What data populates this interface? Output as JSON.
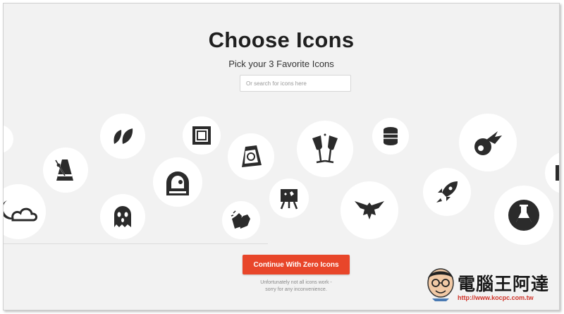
{
  "header": {
    "title": "Choose Icons",
    "subtitle": "Pick your 3 Favorite Icons"
  },
  "search": {
    "placeholder": "Or search for icons here",
    "value": ""
  },
  "icons": [
    "leaves-icon",
    "metronome-icon",
    "cloud-night-icon",
    "frame-icon",
    "astronaut-icon",
    "ghost-icon",
    "ring-box-icon",
    "clapping-hands-icon",
    "champagne-icon",
    "easel-icon",
    "database-icon",
    "eagle-icon",
    "comet-icon",
    "rocket-icon",
    "flask-icon"
  ],
  "cta": {
    "label": "Continue With Zero Icons",
    "accent_color": "#e8462a"
  },
  "note": {
    "line1": "Unfortunately not all icons work -",
    "line2": "sorry for any inconvenience."
  },
  "watermark": {
    "name": "電腦王阿達",
    "url": "http://www.kocpc.com.tw"
  }
}
